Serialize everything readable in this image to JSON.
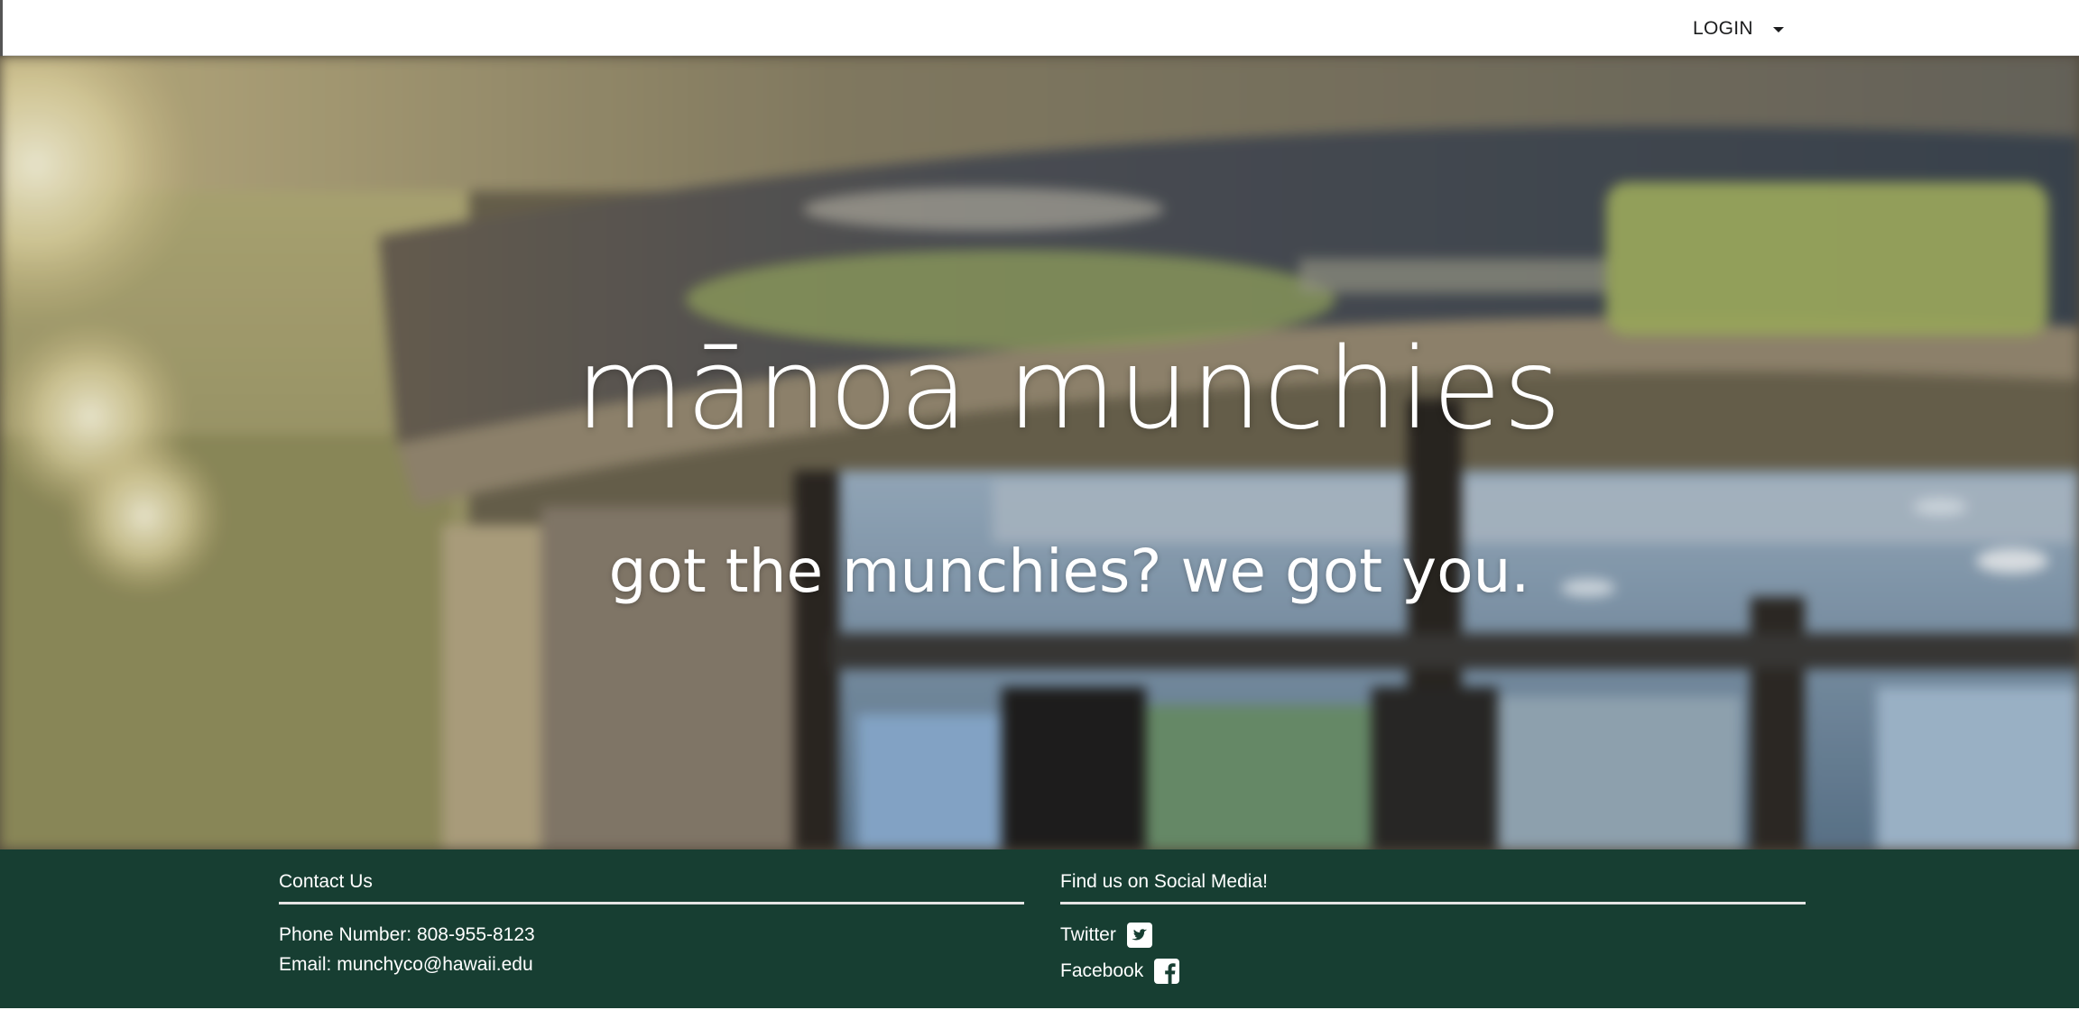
{
  "nav": {
    "login_label": "LOGIN"
  },
  "hero": {
    "title": "mānoa munchies",
    "subtitle": "got the munchies? we got you."
  },
  "footer": {
    "contact": {
      "heading": "Contact Us",
      "phone_label": "Phone Number:",
      "phone_value": "808-955-8123",
      "email_label": "Email:",
      "email_value": "munchyco@hawaii.edu"
    },
    "social": {
      "heading": "Find us on Social Media!",
      "links": [
        {
          "label": "Twitter",
          "icon": "twitter-icon"
        },
        {
          "label": "Facebook",
          "icon": "facebook-icon"
        }
      ]
    }
  },
  "colors": {
    "footer_bg": "#173e32",
    "nav_bg": "#ffffff",
    "hero_text": "#ffffff"
  }
}
